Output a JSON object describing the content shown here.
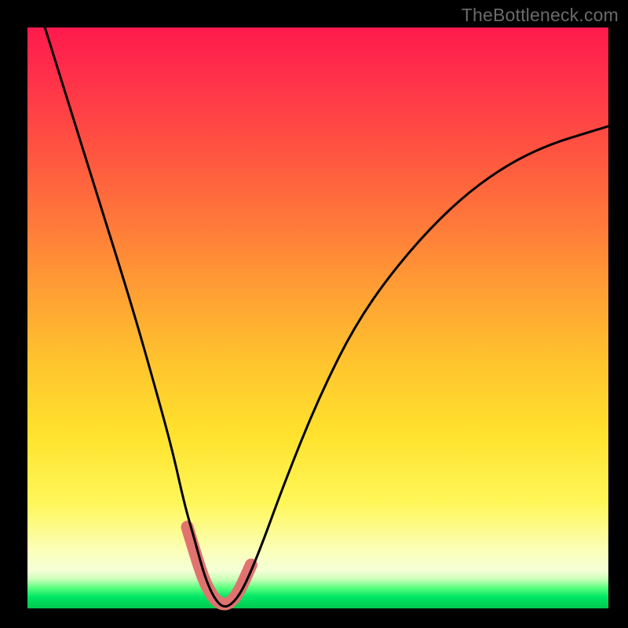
{
  "watermark": "TheBottleneck.com",
  "chart_data": {
    "type": "line",
    "title": "",
    "xlabel": "",
    "ylabel": "",
    "xlim": [
      0,
      1
    ],
    "ylim": [
      0,
      1
    ],
    "series": [
      {
        "name": "bottleneck-curve",
        "color": "#000000",
        "x": [
          0.03,
          0.08,
          0.13,
          0.18,
          0.22,
          0.25,
          0.27,
          0.29,
          0.305,
          0.32,
          0.335,
          0.35,
          0.37,
          0.4,
          0.44,
          0.5,
          0.57,
          0.66,
          0.76,
          0.87,
          1.0
        ],
        "values": [
          1.0,
          0.84,
          0.68,
          0.52,
          0.38,
          0.27,
          0.18,
          0.11,
          0.055,
          0.02,
          0.002,
          0.005,
          0.03,
          0.1,
          0.21,
          0.36,
          0.5,
          0.62,
          0.72,
          0.79,
          0.83
        ]
      },
      {
        "name": "highlight-minimum",
        "color": "#e0736f",
        "x": [
          0.275,
          0.29,
          0.305,
          0.32,
          0.335,
          0.35,
          0.365,
          0.385
        ],
        "values": [
          0.14,
          0.09,
          0.045,
          0.018,
          0.006,
          0.01,
          0.03,
          0.075
        ]
      }
    ],
    "annotations": []
  }
}
